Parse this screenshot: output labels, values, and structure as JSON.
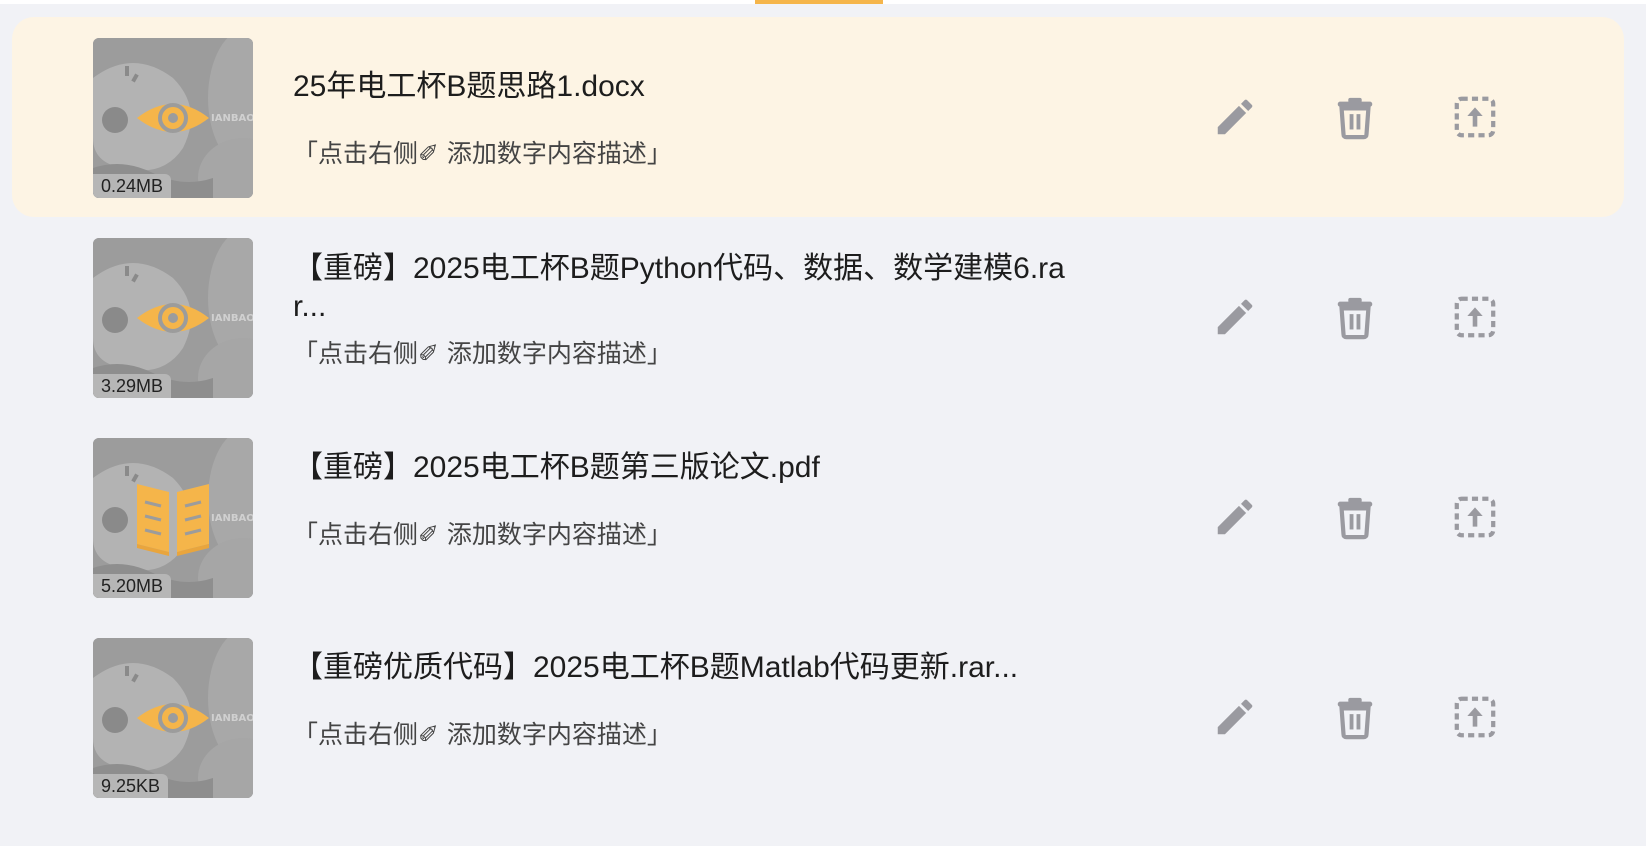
{
  "colors": {
    "accent": "#f5b54a",
    "page_bg": "#f1f2f6",
    "highlight_row_bg": "#fdf4e4",
    "icon_gray": "#9a9aa0"
  },
  "files": [
    {
      "title": "25年电工杯B题思路1.docx",
      "size": "0.24MB",
      "description": "「点击右侧✐ 添加数字内容描述」",
      "type_icon": "eye-icon",
      "highlighted": true
    },
    {
      "title": "【重磅】2025电工杯B题Python代码、数据、数学建模6.rar...",
      "size": "3.29MB",
      "description": "「点击右侧✐ 添加数字内容描述」",
      "type_icon": "eye-icon",
      "highlighted": false
    },
    {
      "title": "【重磅】2025电工杯B题第三版论文.pdf",
      "size": "5.20MB",
      "description": "「点击右侧✐ 添加数字内容描述」",
      "type_icon": "book-icon",
      "highlighted": false
    },
    {
      "title": "【重磅优质代码】2025电工杯B题Matlab代码更新.rar...",
      "size": "9.25KB",
      "description": "「点击右侧✐ 添加数字内容描述」",
      "type_icon": "eye-icon",
      "highlighted": false
    }
  ],
  "actions": [
    "pencil-icon",
    "trash-icon",
    "upload-icon"
  ]
}
